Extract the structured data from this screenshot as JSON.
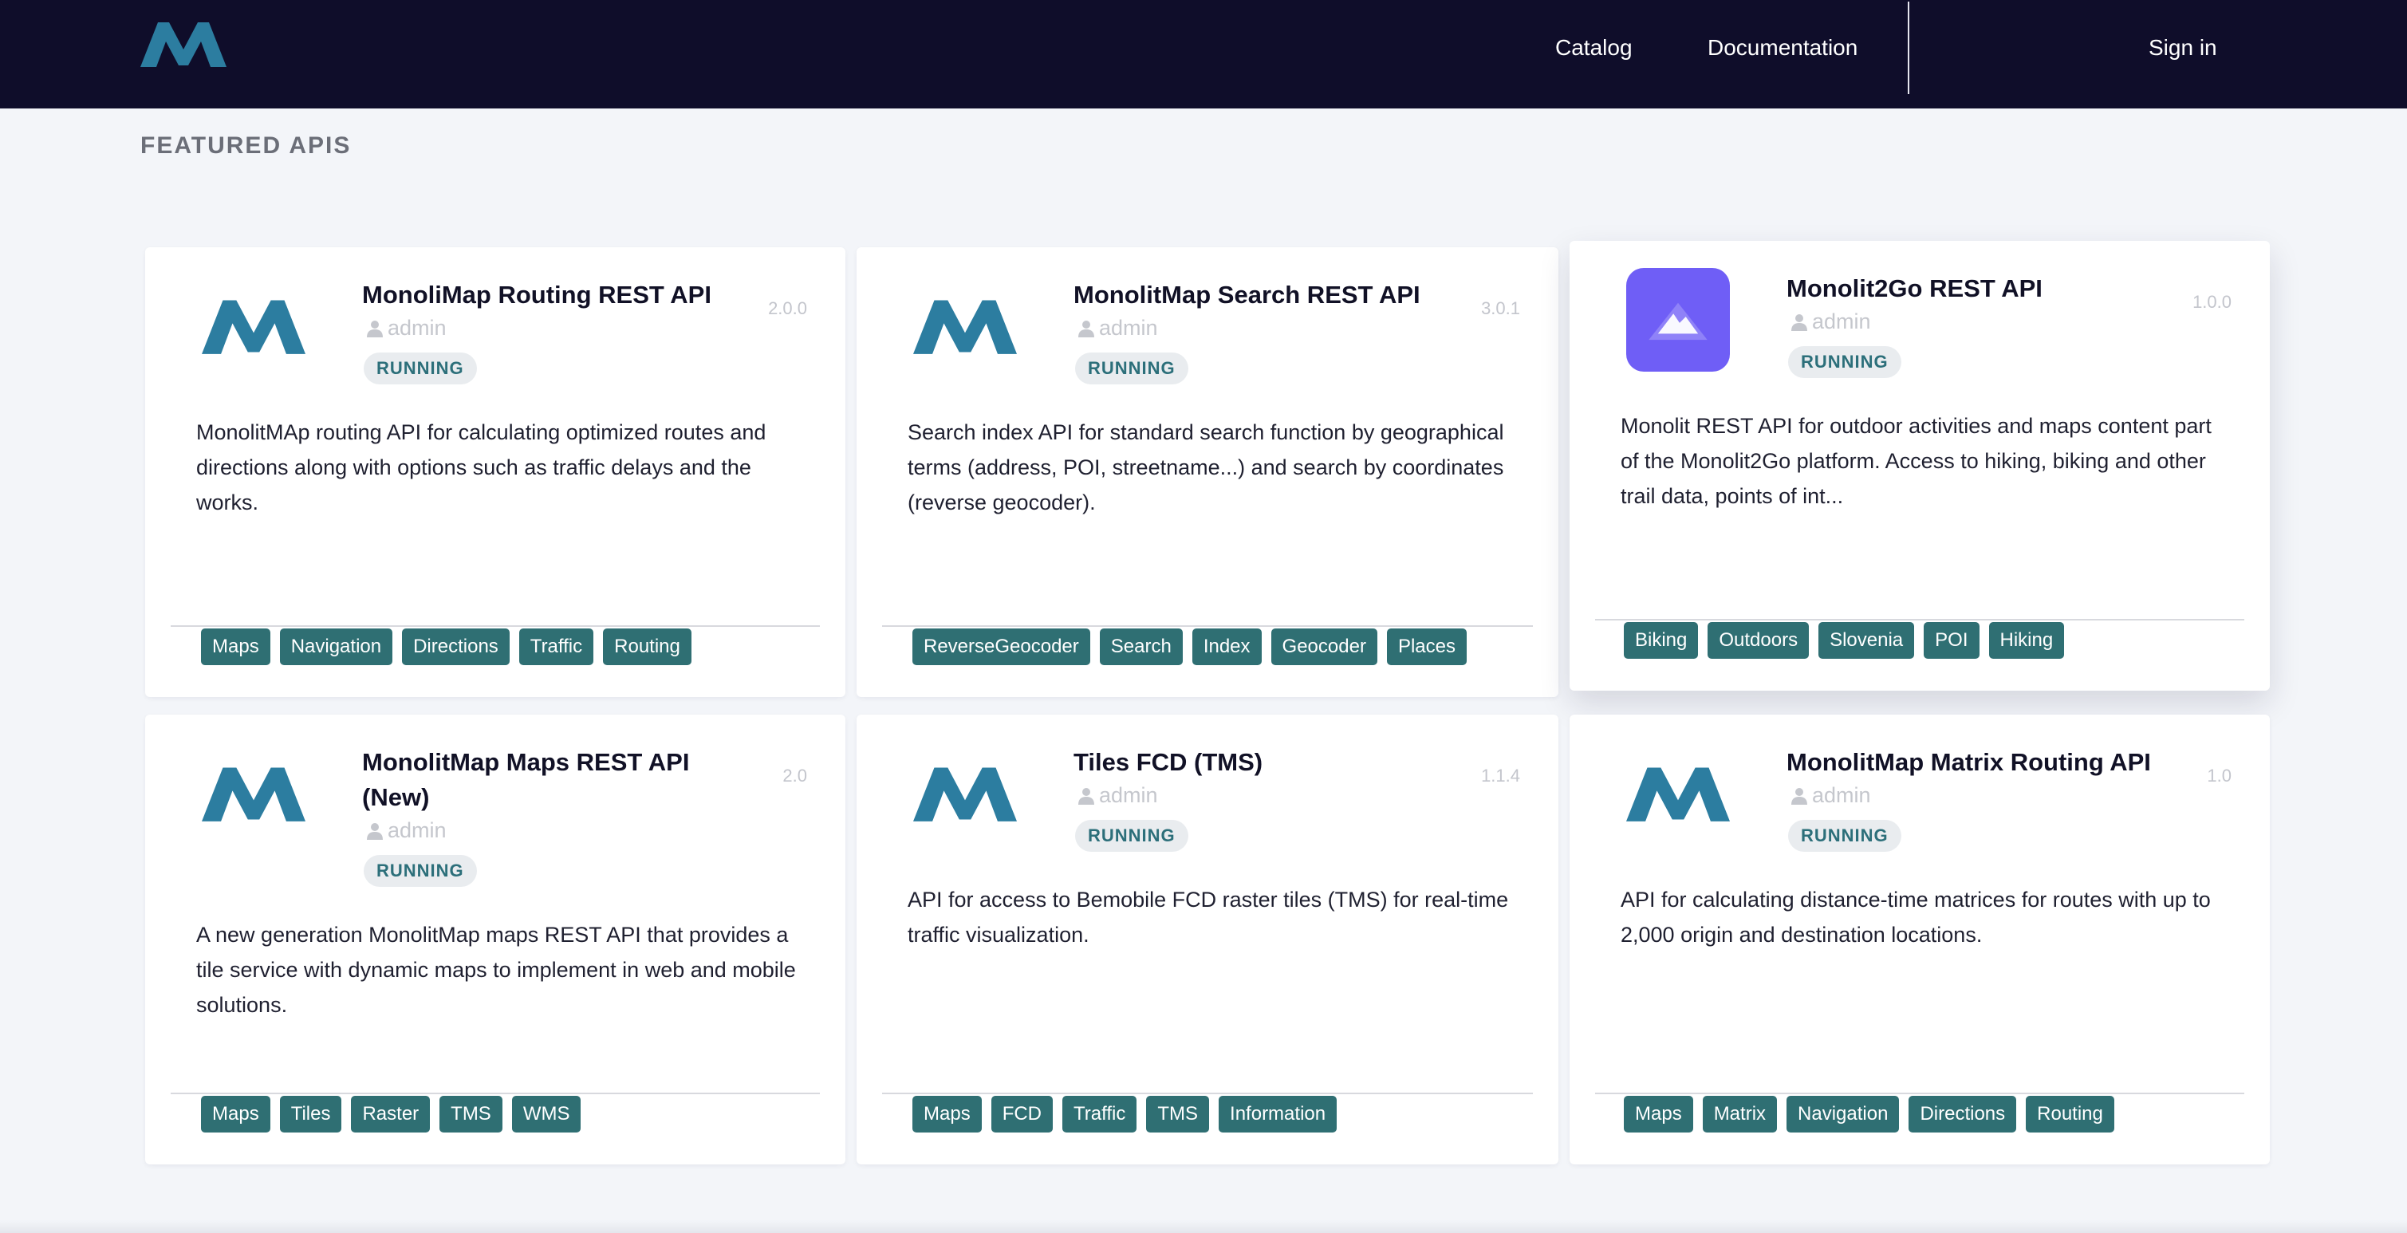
{
  "colors": {
    "topbar_bg": "#0f0d2a",
    "logo_blue": "#2c7da0",
    "tag_bg": "#2f6f73",
    "status_text": "#2c6f7a",
    "app_icon_purple": "#6f5ef6"
  },
  "nav": {
    "logo_icon": "monolit-m-logo",
    "catalog": "Catalog",
    "documentation": "Documentation",
    "sign_in": "Sign in"
  },
  "section": {
    "title": "FEATURED APIS"
  },
  "cards": [
    {
      "icon": "monolit-m-logo",
      "title": "MonoliMap Routing REST API",
      "version": "2.0.0",
      "owner": "admin",
      "status": "RUNNING",
      "description": "MonolitMAp routing API for calculating optimized routes and directions along with options such as traffic delays and the works.",
      "tags": [
        "Maps",
        "Navigation",
        "Directions",
        "Traffic",
        "Routing"
      ]
    },
    {
      "icon": "monolit-m-logo",
      "title": "MonolitMap Search REST API",
      "version": "3.0.1",
      "owner": "admin",
      "status": "RUNNING",
      "description": "Search index API for standard search function by geographical terms (address, POI, streetname...) and search by coordinates (reverse geocoder).",
      "tags": [
        "ReverseGeocoder",
        "Search",
        "Index",
        "Geocoder",
        "Places"
      ]
    },
    {
      "icon": "mountain-app-icon",
      "title": "Monolit2Go REST API",
      "version": "1.0.0",
      "owner": "admin",
      "status": "RUNNING",
      "description": "Monolit REST API for outdoor activities and maps content part of the Monolit2Go platform. Access to hiking, biking and other trail data, points of int...",
      "tags": [
        "Biking",
        "Outdoors",
        "Slovenia",
        "POI",
        "Hiking"
      ]
    },
    {
      "icon": "monolit-m-logo",
      "title": "MonolitMap Maps REST API (New)",
      "version": "2.0",
      "owner": "admin",
      "status": "RUNNING",
      "description": "A new generation MonolitMap maps REST API that provides a tile service with dynamic maps to implement in web and mobile solutions.",
      "tags": [
        "Maps",
        "Tiles",
        "Raster",
        "TMS",
        "WMS"
      ]
    },
    {
      "icon": "monolit-m-logo",
      "title": "Tiles FCD (TMS)",
      "version": "1.1.4",
      "owner": "admin",
      "status": "RUNNING",
      "description": "API for access to Bemobile FCD raster tiles (TMS) for real-time traffic visualization.",
      "tags": [
        "Maps",
        "FCD",
        "Traffic",
        "TMS",
        "Information"
      ]
    },
    {
      "icon": "monolit-m-logo",
      "title": "MonolitMap Matrix Routing API",
      "version": "1.0",
      "owner": "admin",
      "status": "RUNNING",
      "description": "API for calculating distance-time matrices for routes with up to 2,000 origin and destination locations.",
      "tags": [
        "Maps",
        "Matrix",
        "Navigation",
        "Directions",
        "Routing"
      ]
    }
  ]
}
